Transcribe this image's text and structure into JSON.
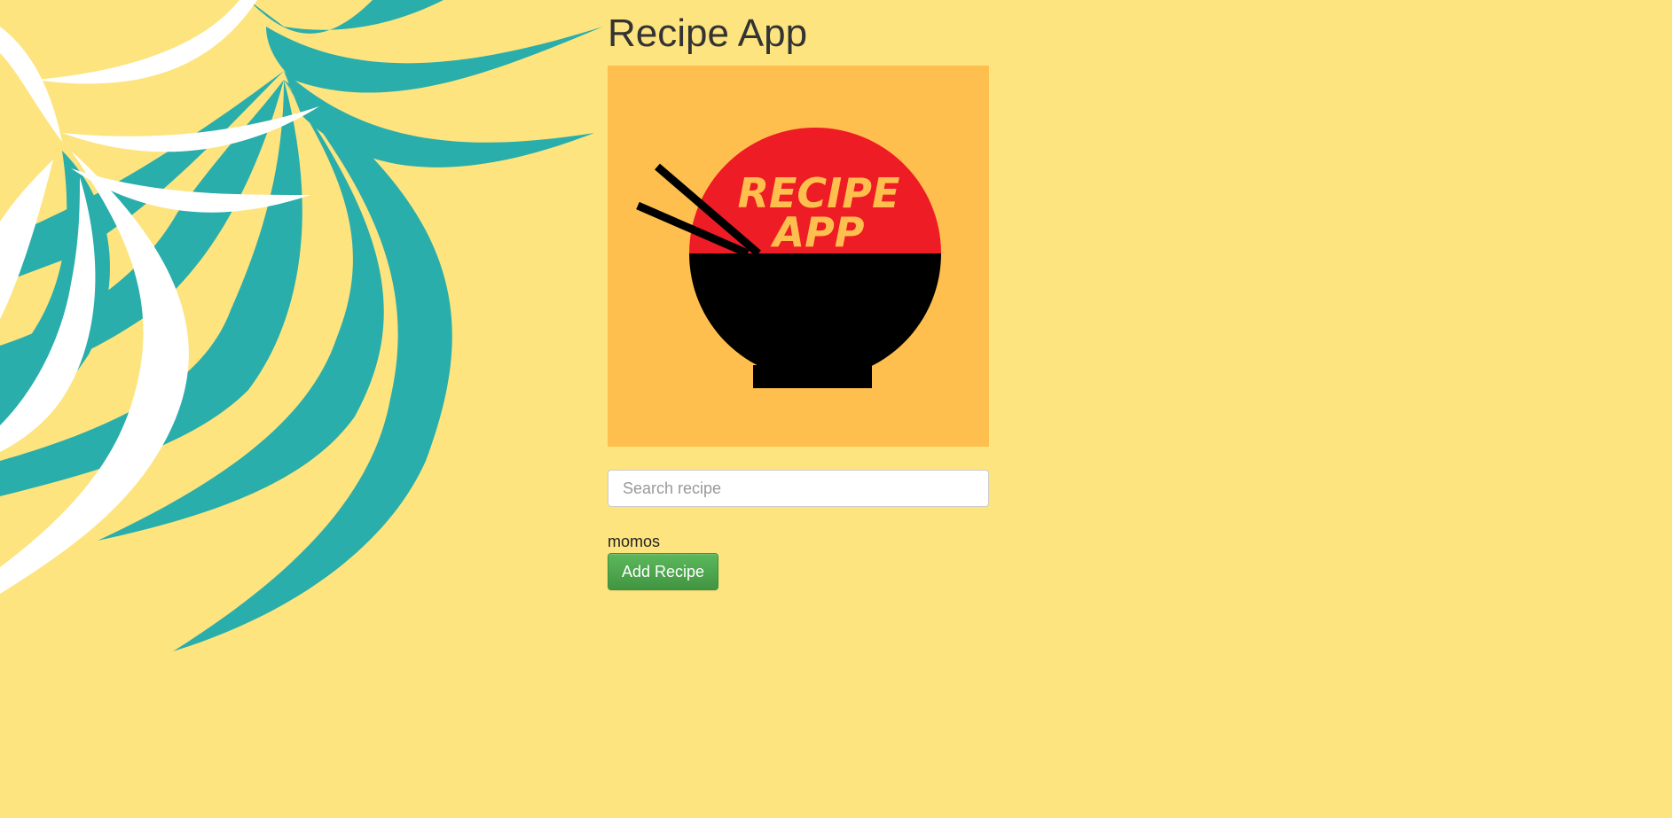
{
  "app": {
    "title": "Recipe App"
  },
  "logo": {
    "line1": "RECIPE",
    "line2": "APP",
    "icon": "rice-bowl-chopsticks-icon"
  },
  "search": {
    "placeholder": "Search recipe",
    "value": ""
  },
  "recipes": [
    {
      "name": "momos"
    }
  ],
  "actions": {
    "add_label": "Add Recipe"
  },
  "colors": {
    "background": "#fde47f",
    "leaf_teal": "#2aaeab",
    "leaf_white": "#ffffff",
    "logo_bg": "#ffbf4e",
    "bowl_red": "#ee1c25",
    "bowl_black": "#000000",
    "logo_text": "#ffbf4e",
    "button_green": "#4cae4c"
  }
}
